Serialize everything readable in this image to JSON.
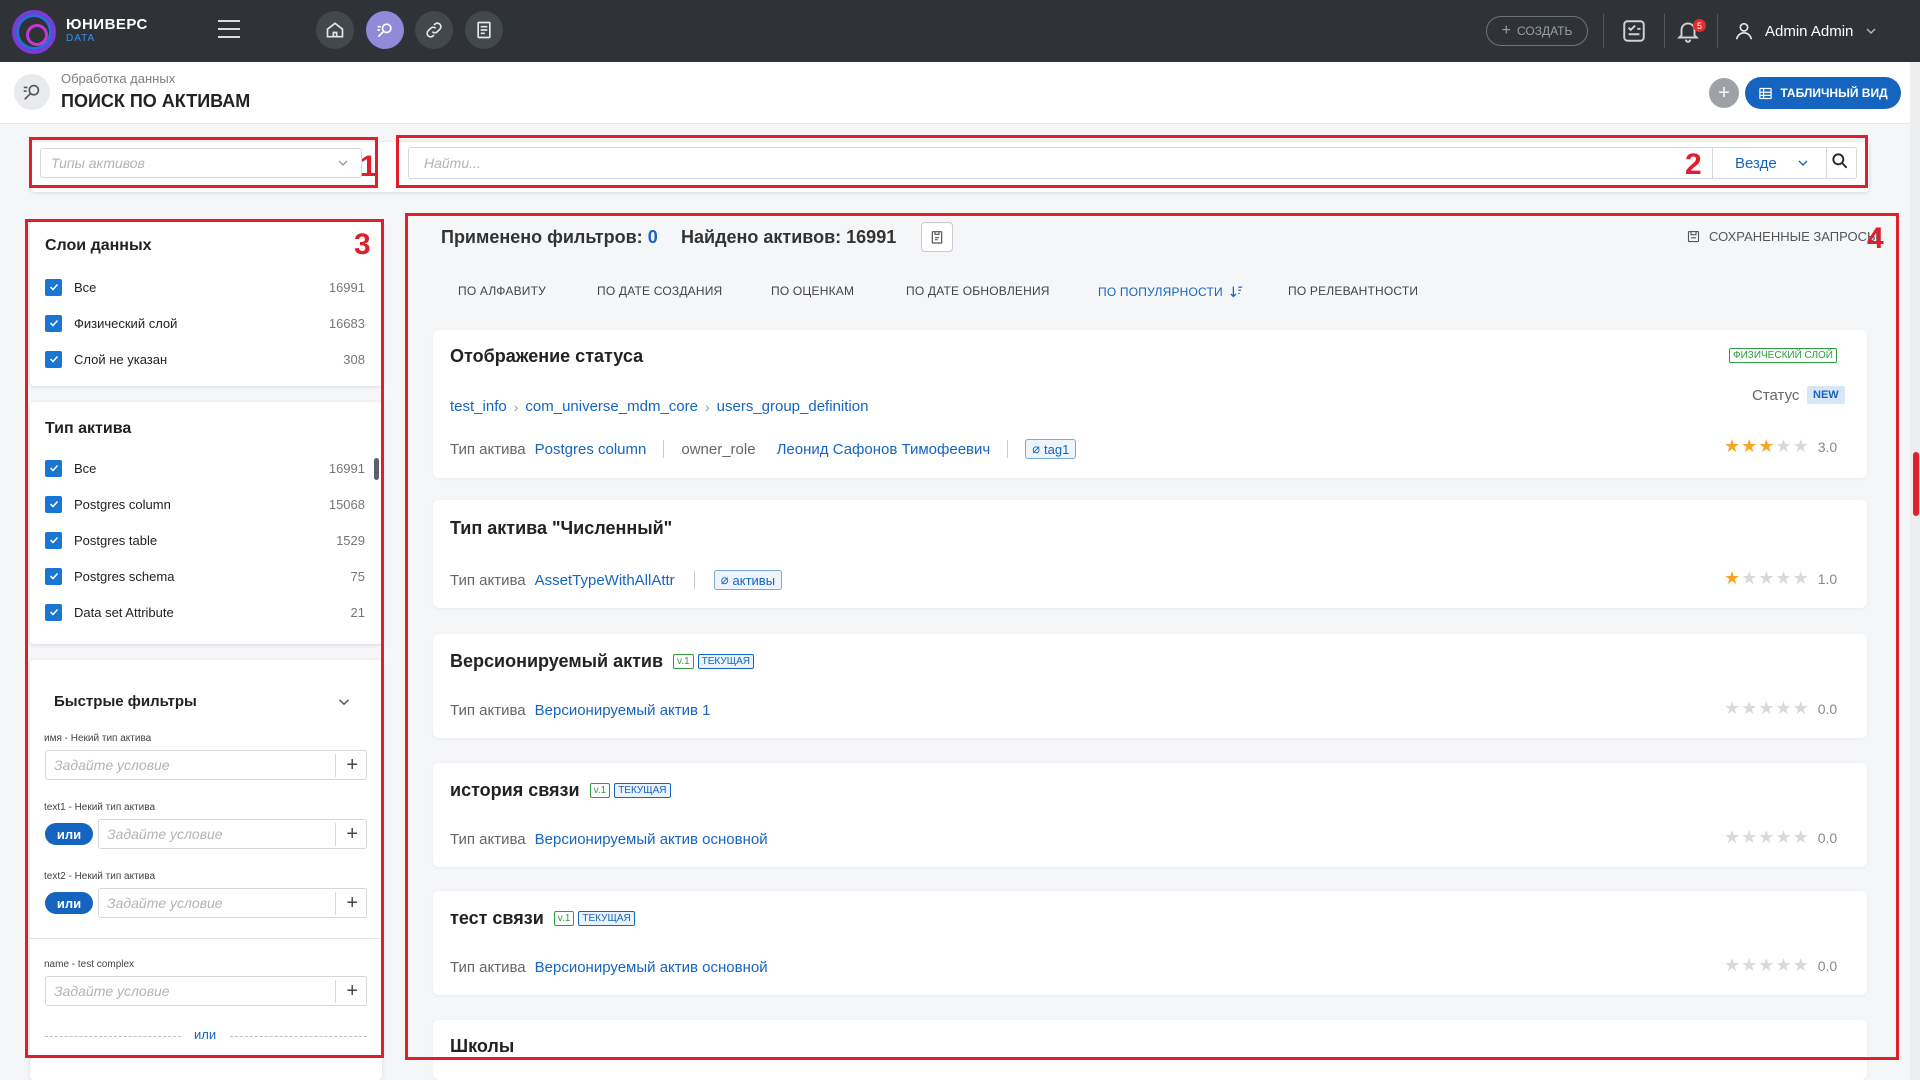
{
  "app": {
    "brand_line1": "ЮНИВЕРС",
    "brand_line2": "DATA"
  },
  "topbar": {
    "create_label": "СОЗДАТЬ",
    "notif_count": "5",
    "user_name": "Admin Admin"
  },
  "header": {
    "breadcrumb": "Обработка данных",
    "title": "ПОИСК ПО АКТИВАМ",
    "table_view_label": "ТАБЛИЧНЫЙ ВИД"
  },
  "search": {
    "types_placeholder": "Типы активов",
    "search_placeholder": "Найти...",
    "scope_value": "Везде"
  },
  "annotations": [
    "1",
    "2",
    "3",
    "4"
  ],
  "filters": {
    "layers": {
      "title": "Слои данных",
      "items": [
        {
          "label": "Все",
          "count": "16991"
        },
        {
          "label": "Физический слой",
          "count": "16683"
        },
        {
          "label": "Слой не указан",
          "count": "308"
        }
      ]
    },
    "asset_type": {
      "title": "Тип актива",
      "items": [
        {
          "label": "Все",
          "count": "16991"
        },
        {
          "label": "Postgres column",
          "count": "15068"
        },
        {
          "label": "Postgres table",
          "count": "1529"
        },
        {
          "label": "Postgres schema",
          "count": "75"
        },
        {
          "label": "Data set Attribute",
          "count": "21"
        }
      ]
    },
    "quick": {
      "title": "Быстрые фильтры",
      "condition_placeholder": "Задайте условие",
      "or_label": "или",
      "items": [
        {
          "label": "имя - Некий тип актива"
        },
        {
          "label": "text1 - Некий тип актива"
        },
        {
          "label": "text2 - Некий тип актива"
        },
        {
          "label": "name - test complex"
        }
      ]
    }
  },
  "results": {
    "applied_label": "Применено фильтров:",
    "applied_count": "0",
    "found_label": "Найдено активов: 16991",
    "saved_queries": "СОХРАНЕННЫЕ ЗАПРОСЫ",
    "sort_options": [
      "ПО АЛФАВИТУ",
      "ПО ДАТЕ СОЗДАНИЯ",
      "ПО ОЦЕНКАМ",
      "ПО ДАТЕ ОБНОВЛЕНИЯ",
      "ПО ПОПУЛЯРНОСТИ",
      "ПО РЕЛЕВАНТНОСТИ"
    ],
    "active_sort": "ПО ПОПУЛЯРНОСТИ",
    "type_label": "Тип актива",
    "cards": [
      {
        "title": "Отображение статуса",
        "layer_badge": "ФИЗИЧЕСКИЙ СЛОЙ",
        "path": [
          "test_info",
          "com_universe_mdm_core",
          "users_group_definition"
        ],
        "status_label": "Статус",
        "status_value": "NEW",
        "type": "Postgres column",
        "owner_role_label": "owner_role",
        "owner": "Леонид Сафонов Тимофеевич",
        "tag": "tag1",
        "rating": 3,
        "rating_text": "3.0"
      },
      {
        "title": "Тип актива \"Численный\"",
        "type": "AssetTypeWithAllAttr",
        "tag": "активы",
        "rating": 1,
        "rating_text": "1.0"
      },
      {
        "title": "Версионируемый актив",
        "version": "v.1",
        "current": "ТЕКУЩАЯ",
        "type": "Версионируемый актив 1",
        "rating": 0,
        "rating_text": "0.0"
      },
      {
        "title": "история связи",
        "version": "v.1",
        "current": "ТЕКУЩАЯ",
        "type": "Версионируемый актив основной",
        "rating": 0,
        "rating_text": "0.0"
      },
      {
        "title": "тест связи",
        "version": "v.1",
        "current": "ТЕКУЩАЯ",
        "type": "Версионируемый актив основной",
        "rating": 0,
        "rating_text": "0.0"
      },
      {
        "title": "Школы"
      }
    ]
  },
  "colors": {
    "accent": "#1565c0",
    "annotation_red": "#e01e2c",
    "topbar": "#2f3337",
    "star": "#f5a623"
  }
}
